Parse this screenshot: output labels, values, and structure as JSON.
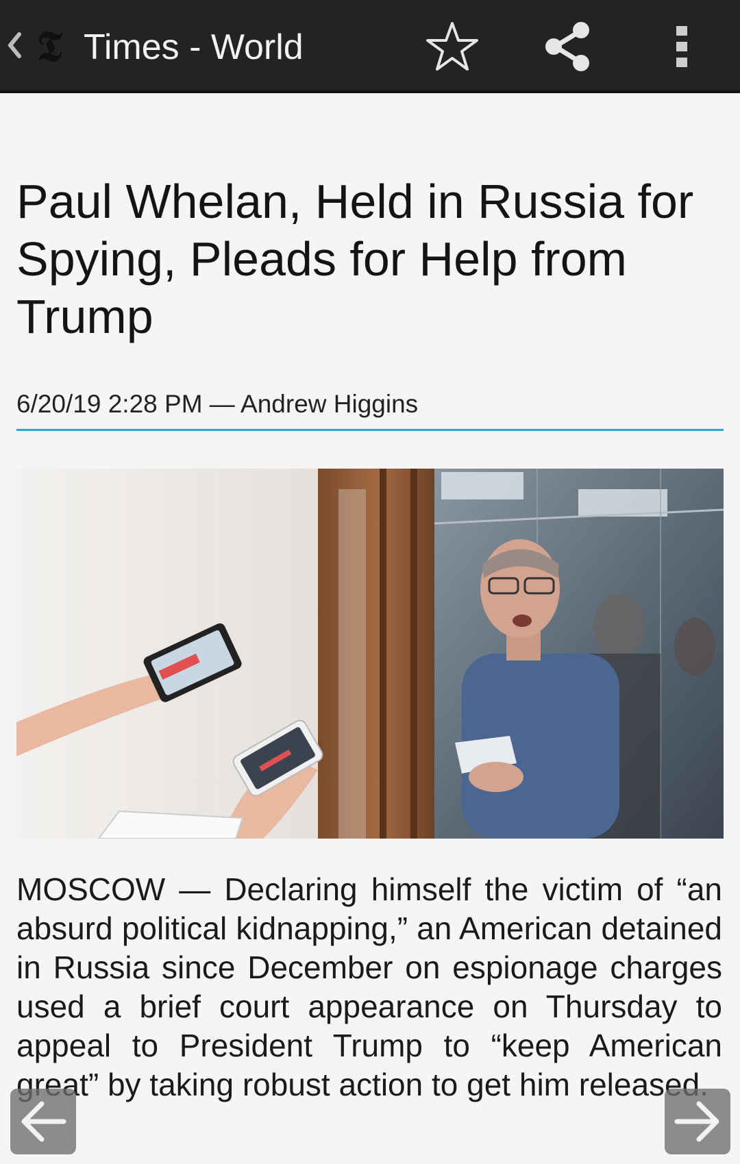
{
  "appbar": {
    "title": "Times - World",
    "logo_glyph": "𝕿",
    "back_icon": "chevron-left-icon",
    "star_icon": "star-outline-icon",
    "share_icon": "share-icon",
    "menu_icon": "overflow-menu-icon"
  },
  "article": {
    "headline": "Paul Whelan, Held in Russia for Spying, Pleads for Help from Trump",
    "byline": "6/20/19 2:28 PM — Andrew Higgins",
    "image": "photo-courtroom",
    "body": "MOSCOW — Declaring himself the victim of “an absurd political kidnapping,” an American detained in Russia since December on espionage charges used a brief court appearance on Thursday to appeal to President Trump to “keep American great” by taking robust action to get him released."
  },
  "nav": {
    "prev_icon": "arrow-left-icon",
    "next_icon": "arrow-right-icon"
  },
  "colors": {
    "appbar_bg": "#232323",
    "page_bg": "#f5f5f5",
    "accent_rule": "#2fa8e0"
  }
}
